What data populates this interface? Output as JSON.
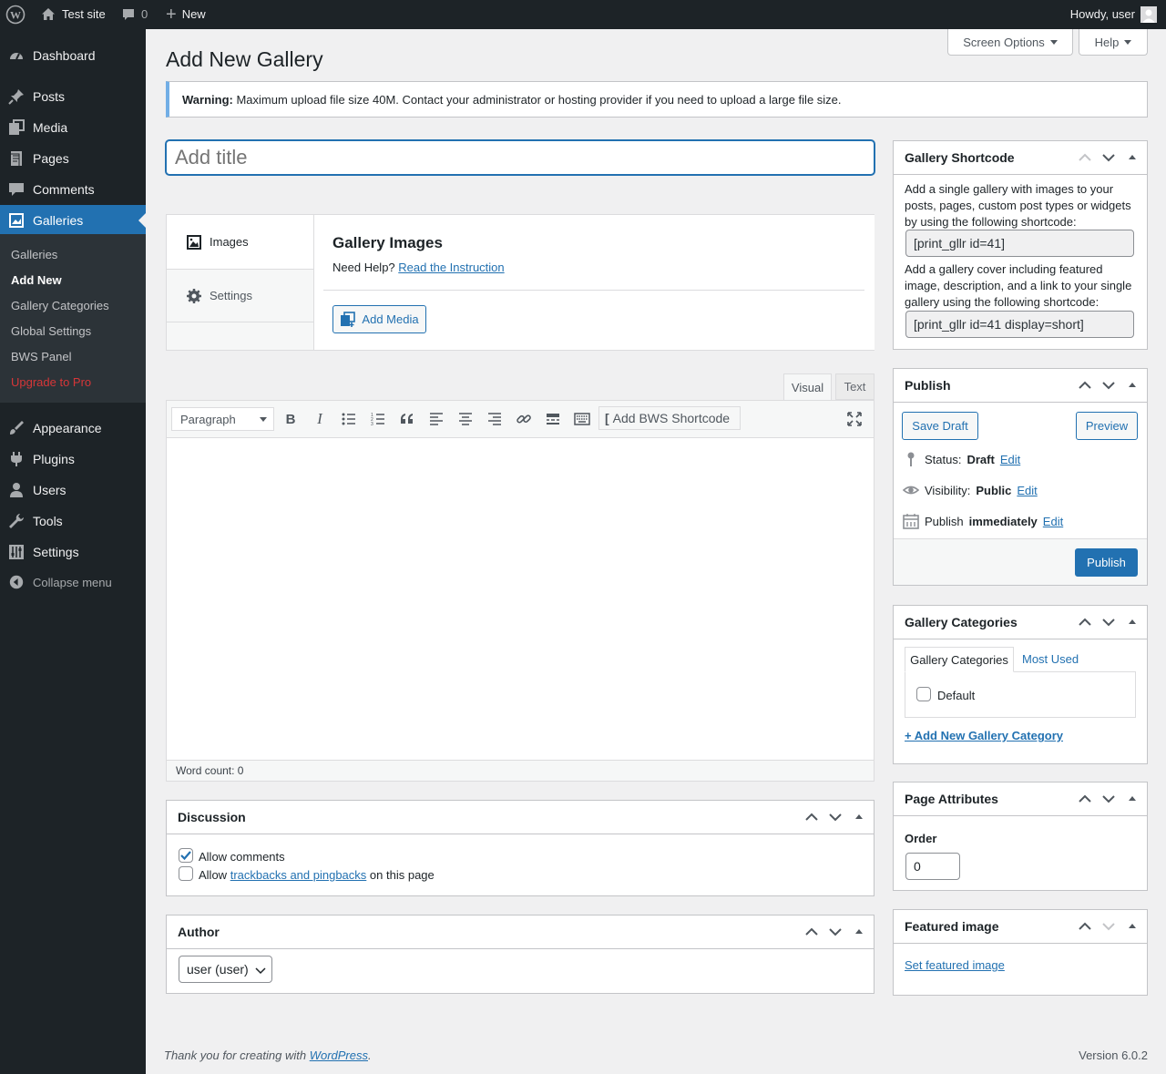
{
  "adminbar": {
    "site_name": "Test site",
    "comments_count": "0",
    "new_label": "New",
    "howdy": "Howdy, user"
  },
  "menu": {
    "dashboard": "Dashboard",
    "posts": "Posts",
    "media": "Media",
    "pages": "Pages",
    "comments": "Comments",
    "galleries": "Galleries",
    "submenu": [
      "Galleries",
      "Add New",
      "Gallery Categories",
      "Global Settings",
      "BWS Panel",
      "Upgrade to Pro"
    ],
    "appearance": "Appearance",
    "plugins": "Plugins",
    "users": "Users",
    "tools": "Tools",
    "settings": "Settings",
    "collapse": "Collapse menu"
  },
  "page": {
    "title": "Add New Gallery",
    "screen_options": "Screen Options",
    "help": "Help"
  },
  "notice": {
    "strong": "Warning:",
    "text": " Maximum upload file size 40M. Contact your administrator or hosting provider if you need to upload a large file size."
  },
  "title_input": {
    "placeholder": "Add title",
    "value": ""
  },
  "gallery_box": {
    "tab_images": "Images",
    "tab_settings": "Settings",
    "heading": "Gallery Images",
    "help_prefix": "Need Help?",
    "help_link": "Read the Instruction",
    "add_media": "Add Media"
  },
  "editor": {
    "tab_visual": "Visual",
    "tab_text": "Text",
    "format_select": "Paragraph",
    "bws_shortcode": "Add BWS Shortcode",
    "word_count": "Word count: 0"
  },
  "discussion": {
    "title": "Discussion",
    "allow_comments": "Allow comments",
    "allow_comments_checked": true,
    "allow_prefix": "Allow",
    "trackbacks_link": "trackbacks and pingbacks",
    "allow_suffix": "on this page",
    "trackbacks_checked": false
  },
  "author": {
    "title": "Author",
    "selected": "user (user)"
  },
  "shortcode_box": {
    "title": "Gallery Shortcode",
    "desc1": "Add a single gallery with images to your posts, pages, custom post types or widgets by using the following shortcode:",
    "code1": "[print_gllr id=41]",
    "desc2": "Add a gallery cover including featured image, description, and a link to your single gallery using the following shortcode:",
    "code2": "[print_gllr id=41 display=short]"
  },
  "publish": {
    "title": "Publish",
    "save_draft": "Save Draft",
    "preview": "Preview",
    "status_label": "Status:",
    "status_value": "Draft",
    "visibility_label": "Visibility:",
    "visibility_value": "Public",
    "publish_label": "Publish",
    "publish_value": "immediately",
    "edit": "Edit",
    "publish_button": "Publish"
  },
  "categories": {
    "title": "Gallery Categories",
    "tab_all": "Gallery Categories",
    "tab_used": "Most Used",
    "item": "Default",
    "add_new": "+ Add New Gallery Category"
  },
  "attributes": {
    "title": "Page Attributes",
    "order_label": "Order",
    "order_value": "0"
  },
  "featured": {
    "title": "Featured image",
    "set_link": "Set featured image"
  },
  "footer": {
    "thanks_prefix": "Thank you for creating with ",
    "wp_link": "WordPress",
    "thanks_suffix": ".",
    "version": "Version 6.0.2"
  },
  "colors": {
    "admin_dark": "#1d2327",
    "accent": "#2271b1",
    "upgrade": "#d63638"
  }
}
